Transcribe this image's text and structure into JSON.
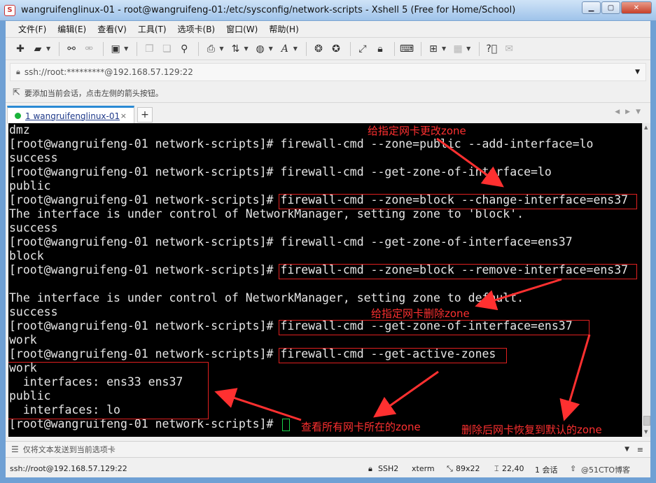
{
  "window": {
    "title": "wangruifenglinux-01 - root@wangruifeng-01:/etc/sysconfig/network-scripts - Xshell 5 (Free for Home/School)"
  },
  "menu": [
    "文件(F)",
    "编辑(E)",
    "查看(V)",
    "工具(T)",
    "选项卡(B)",
    "窗口(W)",
    "帮助(H)"
  ],
  "toolbar": {
    "icons": [
      "new-session-icon",
      "open-folder-icon",
      "connect-icon",
      "disconnect-icon",
      "properties-icon",
      "copy-icon",
      "paste-icon",
      "find-icon",
      "print-icon",
      "transfer-icon",
      "globe-icon",
      "font-icon",
      "xftp-icon",
      "xmanager-icon",
      "fullscreen-icon",
      "lock-icon",
      "keyboard-icon",
      "add-icon",
      "layout-icon",
      "help-icon",
      "chat-icon"
    ]
  },
  "address": {
    "value": "ssh://root:*********@192.168.57.129:22"
  },
  "hint": {
    "text": "要添加当前会话，点击左侧的箭头按钮。"
  },
  "tab": {
    "label": "1 wangruifenglinux-01",
    "close": "×",
    "add": "+"
  },
  "terminal": {
    "lines": [
      "dmz",
      "[root@wangruifeng-01 network-scripts]# firewall-cmd --zone=public --add-interface=lo",
      "success",
      "[root@wangruifeng-01 network-scripts]# firewall-cmd --get-zone-of-interface=lo",
      "public",
      "[root@wangruifeng-01 network-scripts]# firewall-cmd --zone=block --change-interface=ens37",
      "The interface is under control of NetworkManager, setting zone to 'block'.",
      "success",
      "[root@wangruifeng-01 network-scripts]# firewall-cmd --get-zone-of-interface=ens37",
      "block",
      "[root@wangruifeng-01 network-scripts]# firewall-cmd --zone=block --remove-interface=ens37",
      "",
      "The interface is under control of NetworkManager, setting zone to default.",
      "success",
      "[root@wangruifeng-01 network-scripts]# firewall-cmd --get-zone-of-interface=ens37",
      "work",
      "[root@wangruifeng-01 network-scripts]# firewall-cmd --get-active-zones",
      "work",
      "  interfaces: ens33 ens37",
      "public",
      "  interfaces: lo",
      "[root@wangruifeng-01 network-scripts]# "
    ]
  },
  "annotations": {
    "change_zone": "给指定网卡更改zone",
    "remove_zone": "给指定网卡删除zone",
    "view_all": "查看所有网卡所在的zone",
    "restored_default": "删除后网卡恢复到默认的zone",
    "color": "#ff3030"
  },
  "sendbar": {
    "text": "仅将文本发送到当前选项卡"
  },
  "status": {
    "address": "ssh://root@192.168.57.129:22",
    "protocol": "SSH2",
    "term": "xterm",
    "size": "89x22",
    "cursor_pos": "22,40",
    "sessions": "1 会话",
    "watermark": "@51CTO博客"
  }
}
